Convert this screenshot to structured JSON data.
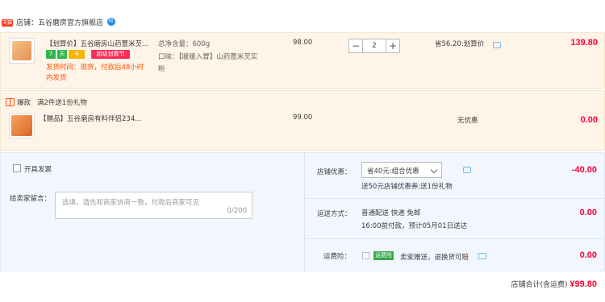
{
  "store": {
    "tag": "天猫",
    "name": "店铺：五谷磨房官方旗舰店",
    "chat": "旺"
  },
  "item1": {
    "title": "【划算价】五谷磨房山药薏米芡...",
    "badges": [
      "7",
      "天",
      "卡",
      "超级划算节"
    ],
    "ship_line1": "发货时间：现货，付款后48小时",
    "ship_line2": "内发货",
    "sku_line1": "总净含量：600g",
    "sku_line2": "口味：【暖暖入胃】山药薏米芡实",
    "sku_line3": "粉",
    "price": "98.00",
    "qty": "2",
    "qty_minus": "−",
    "qty_plus": "+",
    "discount": "省56.20:划算价",
    "total": "139.80"
  },
  "gift_promo": {
    "label": "爆款",
    "desc": "满2件送1份礼物"
  },
  "item2": {
    "title": "【赠品】五谷磨房有料伴侣234...",
    "price": "99.00",
    "discount": "无优惠",
    "total": "0.00"
  },
  "invoice": {
    "label": "开具发票"
  },
  "message": {
    "label": "给卖家留言：",
    "placeholder": "选填，请先和商家协商一致，付款后商家可见",
    "counter": "0/200"
  },
  "coupon": {
    "label": "店铺优惠：",
    "selected": "省40元:组合优惠",
    "note": "送50元店铺优惠券;送1份礼物",
    "amount": "-40.00"
  },
  "shipping": {
    "label": "运送方式：",
    "line1": "普通配送 快递 免邮",
    "line2": "16:00前付款，预计05月01日送达",
    "amount": "0.00"
  },
  "insurance": {
    "label": "运费险：",
    "badge": "运费险",
    "text": "卖家赠送，退换货可赔",
    "amount": "0.00"
  },
  "footer": {
    "label": "店铺合计(含运费)",
    "amount": "¥99.80"
  },
  "colors": {
    "accent": "#ff0036",
    "orange": "#ff5000",
    "row_bg": "#fff4e8",
    "bottom_bg": "#f2f7ff"
  }
}
